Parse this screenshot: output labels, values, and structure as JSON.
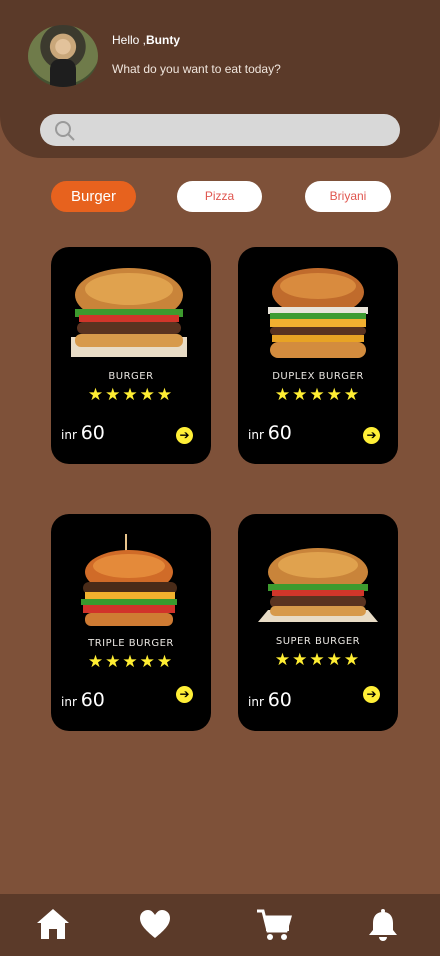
{
  "header": {
    "greeting": "Hello ,",
    "user_name": "Bunty",
    "subtitle": "What do you want to eat today?"
  },
  "search": {
    "placeholder": "",
    "icon": "search-icon"
  },
  "categories": [
    {
      "label": "Burger",
      "active": true
    },
    {
      "label": "Pizza",
      "active": false
    },
    {
      "label": "Briyani",
      "active": false
    }
  ],
  "products": [
    {
      "name": "BURGER",
      "rating": "★★★★★",
      "currency": "inr",
      "price": "60"
    },
    {
      "name": "DUPLEX BURGER",
      "rating": "★★★★★",
      "currency": "inr",
      "price": "60"
    },
    {
      "name": "TRIPLE BURGER",
      "rating": "★★★★★",
      "currency": "inr",
      "price": "60"
    },
    {
      "name": "SUPER BURGER",
      "rating": "★★★★★",
      "currency": "inr",
      "price": "60"
    }
  ],
  "nav": [
    "home-icon",
    "heart-icon",
    "cart-icon",
    "bell-icon"
  ],
  "colors": {
    "background": "#7e5139",
    "header": "#5b3a29",
    "accent": "#e7621e",
    "card": "#000000",
    "star": "#ffee33"
  }
}
